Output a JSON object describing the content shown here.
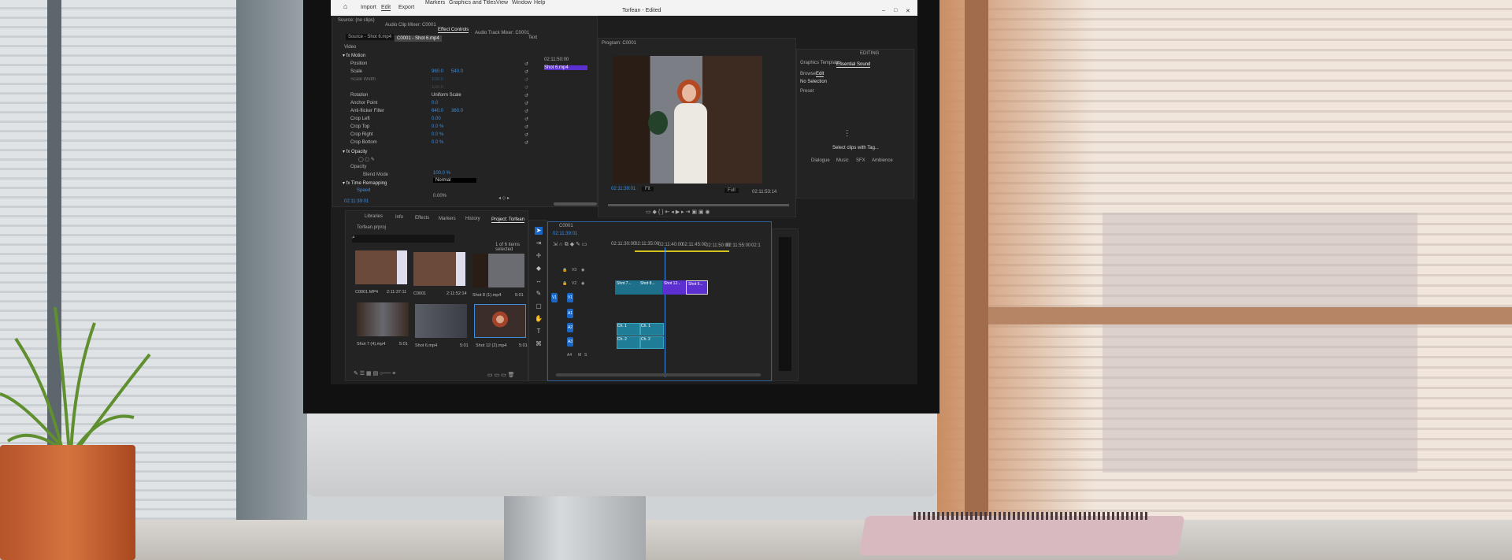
{
  "menu": {
    "home_icon": "home-icon",
    "import": "Import",
    "edit": "Edit",
    "export": "Export",
    "items": [
      "Markers",
      "Graphics and Titles",
      "View",
      "Window",
      "Help"
    ],
    "doc_title": "Torfean - Edited"
  },
  "source_panel": {
    "label": "Source: (no clips)",
    "audio_clip_mixer": "Audio Clip Mixer: C0001",
    "effect_controls": "Effect Controls",
    "audio_track_mixer": "Audio Track Mixer: C0001",
    "text_tab": "Text",
    "source_tab": "Source - Shot 6.mp4",
    "sequence_tab": "C0001 - Shot 6.mp4",
    "video": "Video",
    "motion": "Motion",
    "timecode_header": "02:11:50:00",
    "clip_label": "Shot 6.mp4",
    "properties": [
      {
        "label": "Position",
        "v1": "",
        "v2": ""
      },
      {
        "label": "Scale",
        "v1": "960.0",
        "v2": "540.0"
      },
      {
        "label": "Scale Width",
        "v1": "100.0",
        "v2": ""
      },
      {
        "label": "",
        "v1": "100.0",
        "v2": ""
      },
      {
        "label": "Rotation",
        "v1": "Uniform Scale",
        "v2": ""
      },
      {
        "label": "Anchor Point",
        "v1": "0.0",
        "v2": ""
      },
      {
        "label": "Anti-flicker Filter",
        "v1": "640.0",
        "v2": "360.0"
      },
      {
        "label": "Crop Left",
        "v1": "0.00",
        "v2": ""
      },
      {
        "label": "Crop Top",
        "v1": "0.0 %",
        "v2": ""
      },
      {
        "label": "Crop Right",
        "v1": "0.0 %",
        "v2": ""
      },
      {
        "label": "Crop Bottom",
        "v1": "0.0 %",
        "v2": ""
      }
    ],
    "opacity_section": "Opacity",
    "opacity": "Opacity",
    "opacity_value": "100.0 %",
    "blend_mode": "Blend Mode",
    "blend_value": "Normal",
    "time_remapping": "Time Remapping",
    "speed": "Speed",
    "speed_value": "0.00%",
    "timecode": "02:11:39:01"
  },
  "program": {
    "title": "Program: C0001",
    "timecode": "02:11:39:01",
    "fit": "Fit",
    "quality": "Full",
    "duration": "02:11:53:14"
  },
  "essential_sound": {
    "workspace": "EDITING",
    "graphics_templates": "Graphics Templates",
    "title": "Essential Sound",
    "browse": "Browse",
    "edit": "Edit",
    "no_selection": "No Selection",
    "preset": "Preset",
    "message": "Select clips with Tag...",
    "types": [
      "Dialogue",
      "Music",
      "SFX",
      "Ambience"
    ]
  },
  "project": {
    "tabs": [
      "Libraries",
      "Info",
      "Effects",
      "Markers",
      "History",
      "Project: Torfean"
    ],
    "file": "Torfean.prproj",
    "selected": "1 of 6 items selected",
    "items": [
      {
        "name": "C0001.MP4",
        "duration": "2:11:37:11"
      },
      {
        "name": "C0001",
        "duration": "2:11:52:14"
      },
      {
        "name": "Shot 8 (1).mp4",
        "duration": "5:01"
      },
      {
        "name": "Shot 7 (4).mp4",
        "duration": "5:01"
      },
      {
        "name": "Shot 6.mp4",
        "duration": "5:01"
      },
      {
        "name": "Shot 12 (2).mp4",
        "duration": "5:01"
      }
    ]
  },
  "timeline": {
    "sequence": "C0001",
    "timecode": "02:11:39:01",
    "ruler": [
      "02:11:30:00",
      "02:11:35:00",
      "02:11:40:00",
      "02:11:45:00",
      "02:11:50:00",
      "02:11:55:00",
      "02:1"
    ],
    "video_tracks": [
      "V3",
      "V2",
      "V1"
    ],
    "audio_tracks": [
      "A1",
      "A2",
      "A3",
      "A4"
    ],
    "source_v": "V1",
    "clips": [
      "Shot 7...",
      "Shot 8...",
      "Shot 12...",
      "Shot 6..."
    ],
    "audio_labels": [
      "Ch. 1",
      "Ch. 1",
      "Ch. 2",
      "Ch. 2"
    ],
    "m": "M",
    "s": "S"
  },
  "colors": {
    "accent": "#1a67c8",
    "clip_teal": "#1d6f8a",
    "clip_purple": "#5b2fd0",
    "playhead": "#3d8ee0"
  }
}
